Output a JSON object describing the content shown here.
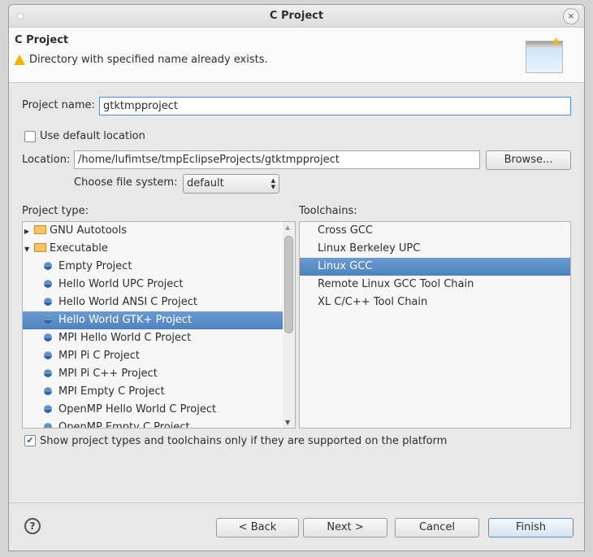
{
  "window": {
    "title": "C Project"
  },
  "header": {
    "title": "C Project",
    "message": "Directory with specified name already exists."
  },
  "form": {
    "project_name_label": "Project name:",
    "project_name_value": "gtktmpproject",
    "use_default_location_label": "Use default location",
    "use_default_location_checked": false,
    "location_label": "Location:",
    "location_value": "/home/lufimtse/tmpEclipseProjects/gtktmpproject",
    "browse_label": "Browse...",
    "file_system_label": "Choose file system:",
    "file_system_value": "default"
  },
  "project_types": {
    "label": "Project type:",
    "items": [
      {
        "label": "GNU Autotools",
        "kind": "folder",
        "expanded": false
      },
      {
        "label": "Executable",
        "kind": "folder",
        "expanded": true
      },
      {
        "label": "Empty Project",
        "kind": "item"
      },
      {
        "label": "Hello World UPC Project",
        "kind": "item"
      },
      {
        "label": "Hello World ANSI C Project",
        "kind": "item"
      },
      {
        "label": "Hello World GTK+ Project",
        "kind": "item",
        "selected": true
      },
      {
        "label": "MPI Hello World C Project",
        "kind": "item"
      },
      {
        "label": "MPI Pi C Project",
        "kind": "item"
      },
      {
        "label": "MPI Pi C++ Project",
        "kind": "item"
      },
      {
        "label": "MPI Empty C Project",
        "kind": "item"
      },
      {
        "label": "OpenMP Hello World C Project",
        "kind": "item"
      },
      {
        "label": "OpenMP Empty C Project",
        "kind": "item"
      }
    ]
  },
  "toolchains": {
    "label": "Toolchains:",
    "items": [
      {
        "label": "Cross GCC"
      },
      {
        "label": "Linux Berkeley UPC"
      },
      {
        "label": "Linux GCC",
        "selected": true
      },
      {
        "label": "Remote Linux GCC Tool Chain"
      },
      {
        "label": "XL C/C++ Tool Chain"
      }
    ]
  },
  "filter": {
    "label": "Show project types and toolchains only if they are supported on the platform",
    "checked": true
  },
  "buttons": {
    "back": "< Back",
    "next": "Next >",
    "cancel": "Cancel",
    "finish": "Finish"
  },
  "colors": {
    "selection": "#5a8cc6",
    "warning": "#f0b400"
  }
}
